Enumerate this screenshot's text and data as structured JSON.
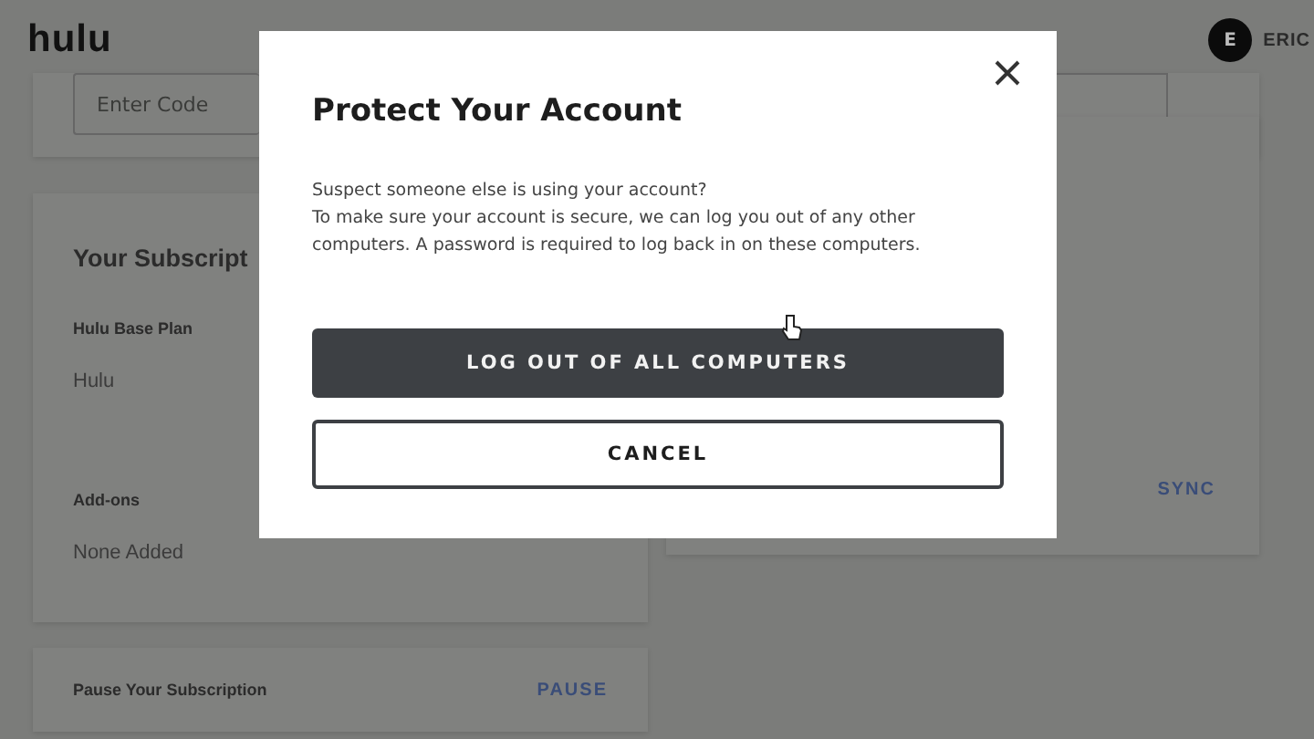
{
  "header": {
    "logo": "hulu",
    "user": {
      "initial": "E",
      "name": "ERIC"
    }
  },
  "code_card": {
    "placeholder": "Enter Code"
  },
  "subscription": {
    "title": "Your Subscript",
    "plan_label": "Hulu Base Plan",
    "plan": "Hulu",
    "addons_label": "Add-ons",
    "addons": "None Added"
  },
  "pause": {
    "label": "Pause Your Subscription",
    "action": "PAUSE"
  },
  "side_card": {
    "action": "SYNC"
  },
  "dialog": {
    "title": "Protect Your Account",
    "body": [
      "Suspect someone else is using your account?",
      "To make sure your account is secure, we can log you out of any other computers. A password is required to log back in on these computers."
    ],
    "buttons": [
      {
        "label": "LOG OUT OF ALL COMPUTERS",
        "kind": "primary"
      },
      {
        "label": "CANCEL",
        "kind": "secondary"
      }
    ]
  }
}
